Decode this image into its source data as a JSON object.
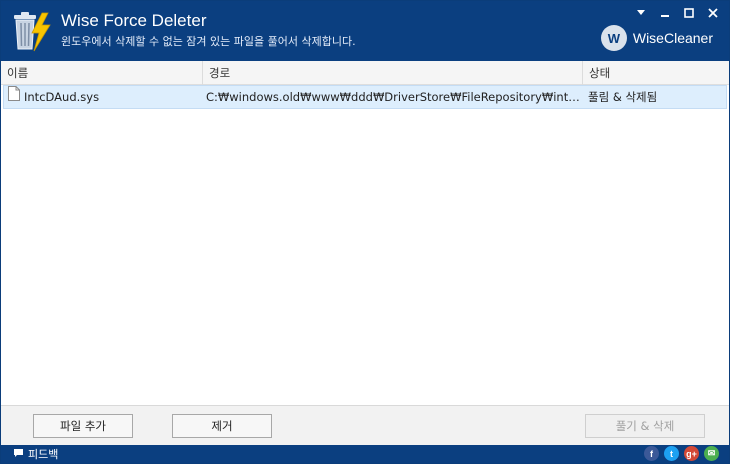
{
  "window": {
    "title": "Wise Force Deleter",
    "subtitle": "윈도우에서 삭제할 수 없는 잠겨 있는 파일을 풀어서 삭제합니다.",
    "brand": "WiseCleaner",
    "brand_badge": "W",
    "controls": [
      {
        "name": "menu",
        "icon": "menu-icon"
      },
      {
        "name": "minimize",
        "icon": "minimize-icon"
      },
      {
        "name": "maximize",
        "icon": "maximize-icon"
      },
      {
        "name": "close",
        "icon": "close-icon"
      }
    ]
  },
  "table": {
    "columns": {
      "name": "이름",
      "path": "경로",
      "status": "상태"
    },
    "rows": [
      {
        "name": "IntcDAud.sys",
        "path": "C:₩windows.old₩www₩ddd₩DriverStore₩FileRepository₩intc...",
        "status": "풀림 & 삭제됨"
      }
    ]
  },
  "actions": {
    "add_file": "파일 추가",
    "remove": "제거",
    "unlock_delete": "풀기 & 삭제"
  },
  "footer": {
    "feedback": "피드백",
    "social": [
      {
        "name": "facebook",
        "glyph": "f",
        "color": "#3b5998"
      },
      {
        "name": "twitter",
        "glyph": "t",
        "color": "#1da1f2"
      },
      {
        "name": "googleplus",
        "glyph": "g+",
        "color": "#d34836"
      },
      {
        "name": "email",
        "glyph": "✉",
        "color": "#4caf50"
      }
    ]
  },
  "colors": {
    "header_bg": "#0b3f80",
    "selected_row": "#ddeefd",
    "accent_logo": "#f7c400"
  }
}
